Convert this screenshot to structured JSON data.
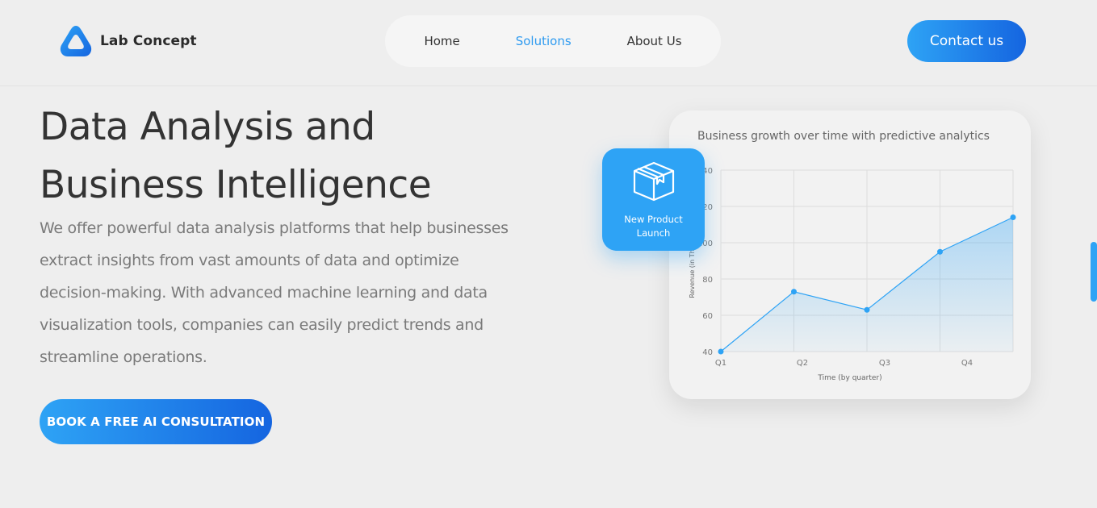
{
  "brand": {
    "name": "Lab Concept",
    "accent": "#2ea3f5",
    "accent_dark": "#1565e0"
  },
  "nav": {
    "items": [
      {
        "label": "Home",
        "active": false
      },
      {
        "label": "Solutions",
        "active": true
      },
      {
        "label": "About Us",
        "active": false
      }
    ]
  },
  "header": {
    "contact_label": "Contact us"
  },
  "hero": {
    "title_line1": "Data Analysis and",
    "title_line2": "Business Intelligence",
    "description": "We offer powerful data analysis platforms that help businesses extract insights from vast amounts of data and optimize decision-making. With advanced machine learning and data visualization tools, companies can easily predict trends and streamline operations.",
    "cta_label": "BOOK A FREE AI CONSULTATION"
  },
  "badge": {
    "icon": "box-icon",
    "label": "New Product Launch"
  },
  "chart_data": {
    "type": "area",
    "title": "Business growth over time with predictive analytics",
    "xlabel": "Time (by quarter)",
    "ylabel": "Revenue (in Tho",
    "x_ticks": [
      "Q1",
      "Q2",
      "Q3",
      "Q4"
    ],
    "y_ticks": [
      40,
      60,
      80,
      100,
      120,
      140
    ],
    "ylim": [
      40,
      140
    ],
    "grid": true,
    "x": [
      1,
      2,
      3,
      4,
      5
    ],
    "y": [
      40,
      73,
      63,
      95,
      114
    ],
    "series_color": "#2ea3f5"
  }
}
